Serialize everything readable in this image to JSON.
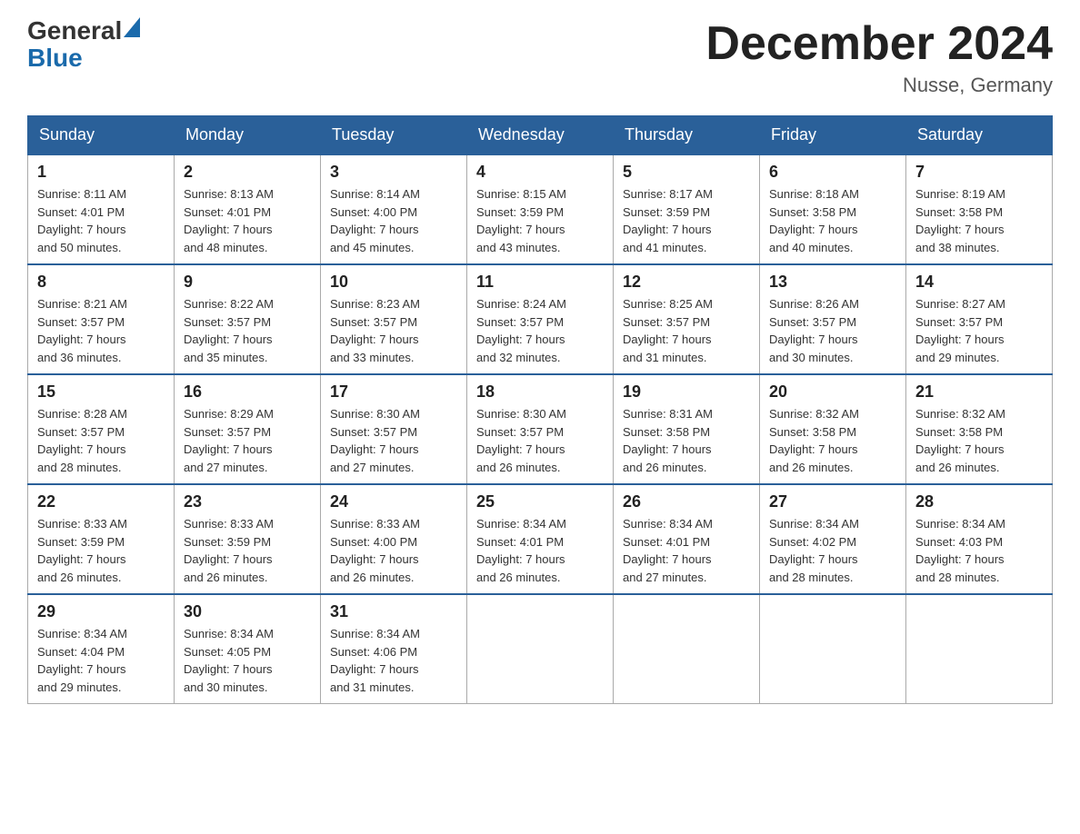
{
  "header": {
    "logo_general": "General",
    "logo_blue": "Blue",
    "title": "December 2024",
    "subtitle": "Nusse, Germany"
  },
  "days_of_week": [
    "Sunday",
    "Monday",
    "Tuesday",
    "Wednesday",
    "Thursday",
    "Friday",
    "Saturday"
  ],
  "weeks": [
    [
      {
        "day": "1",
        "sunrise": "8:11 AM",
        "sunset": "4:01 PM",
        "daylight": "7 hours and 50 minutes."
      },
      {
        "day": "2",
        "sunrise": "8:13 AM",
        "sunset": "4:01 PM",
        "daylight": "7 hours and 48 minutes."
      },
      {
        "day": "3",
        "sunrise": "8:14 AM",
        "sunset": "4:00 PM",
        "daylight": "7 hours and 45 minutes."
      },
      {
        "day": "4",
        "sunrise": "8:15 AM",
        "sunset": "3:59 PM",
        "daylight": "7 hours and 43 minutes."
      },
      {
        "day": "5",
        "sunrise": "8:17 AM",
        "sunset": "3:59 PM",
        "daylight": "7 hours and 41 minutes."
      },
      {
        "day": "6",
        "sunrise": "8:18 AM",
        "sunset": "3:58 PM",
        "daylight": "7 hours and 40 minutes."
      },
      {
        "day": "7",
        "sunrise": "8:19 AM",
        "sunset": "3:58 PM",
        "daylight": "7 hours and 38 minutes."
      }
    ],
    [
      {
        "day": "8",
        "sunrise": "8:21 AM",
        "sunset": "3:57 PM",
        "daylight": "7 hours and 36 minutes."
      },
      {
        "day": "9",
        "sunrise": "8:22 AM",
        "sunset": "3:57 PM",
        "daylight": "7 hours and 35 minutes."
      },
      {
        "day": "10",
        "sunrise": "8:23 AM",
        "sunset": "3:57 PM",
        "daylight": "7 hours and 33 minutes."
      },
      {
        "day": "11",
        "sunrise": "8:24 AM",
        "sunset": "3:57 PM",
        "daylight": "7 hours and 32 minutes."
      },
      {
        "day": "12",
        "sunrise": "8:25 AM",
        "sunset": "3:57 PM",
        "daylight": "7 hours and 31 minutes."
      },
      {
        "day": "13",
        "sunrise": "8:26 AM",
        "sunset": "3:57 PM",
        "daylight": "7 hours and 30 minutes."
      },
      {
        "day": "14",
        "sunrise": "8:27 AM",
        "sunset": "3:57 PM",
        "daylight": "7 hours and 29 minutes."
      }
    ],
    [
      {
        "day": "15",
        "sunrise": "8:28 AM",
        "sunset": "3:57 PM",
        "daylight": "7 hours and 28 minutes."
      },
      {
        "day": "16",
        "sunrise": "8:29 AM",
        "sunset": "3:57 PM",
        "daylight": "7 hours and 27 minutes."
      },
      {
        "day": "17",
        "sunrise": "8:30 AM",
        "sunset": "3:57 PM",
        "daylight": "7 hours and 27 minutes."
      },
      {
        "day": "18",
        "sunrise": "8:30 AM",
        "sunset": "3:57 PM",
        "daylight": "7 hours and 26 minutes."
      },
      {
        "day": "19",
        "sunrise": "8:31 AM",
        "sunset": "3:58 PM",
        "daylight": "7 hours and 26 minutes."
      },
      {
        "day": "20",
        "sunrise": "8:32 AM",
        "sunset": "3:58 PM",
        "daylight": "7 hours and 26 minutes."
      },
      {
        "day": "21",
        "sunrise": "8:32 AM",
        "sunset": "3:58 PM",
        "daylight": "7 hours and 26 minutes."
      }
    ],
    [
      {
        "day": "22",
        "sunrise": "8:33 AM",
        "sunset": "3:59 PM",
        "daylight": "7 hours and 26 minutes."
      },
      {
        "day": "23",
        "sunrise": "8:33 AM",
        "sunset": "3:59 PM",
        "daylight": "7 hours and 26 minutes."
      },
      {
        "day": "24",
        "sunrise": "8:33 AM",
        "sunset": "4:00 PM",
        "daylight": "7 hours and 26 minutes."
      },
      {
        "day": "25",
        "sunrise": "8:34 AM",
        "sunset": "4:01 PM",
        "daylight": "7 hours and 26 minutes."
      },
      {
        "day": "26",
        "sunrise": "8:34 AM",
        "sunset": "4:01 PM",
        "daylight": "7 hours and 27 minutes."
      },
      {
        "day": "27",
        "sunrise": "8:34 AM",
        "sunset": "4:02 PM",
        "daylight": "7 hours and 28 minutes."
      },
      {
        "day": "28",
        "sunrise": "8:34 AM",
        "sunset": "4:03 PM",
        "daylight": "7 hours and 28 minutes."
      }
    ],
    [
      {
        "day": "29",
        "sunrise": "8:34 AM",
        "sunset": "4:04 PM",
        "daylight": "7 hours and 29 minutes."
      },
      {
        "day": "30",
        "sunrise": "8:34 AM",
        "sunset": "4:05 PM",
        "daylight": "7 hours and 30 minutes."
      },
      {
        "day": "31",
        "sunrise": "8:34 AM",
        "sunset": "4:06 PM",
        "daylight": "7 hours and 31 minutes."
      },
      null,
      null,
      null,
      null
    ]
  ],
  "labels": {
    "sunrise": "Sunrise:",
    "sunset": "Sunset:",
    "daylight": "Daylight:"
  }
}
